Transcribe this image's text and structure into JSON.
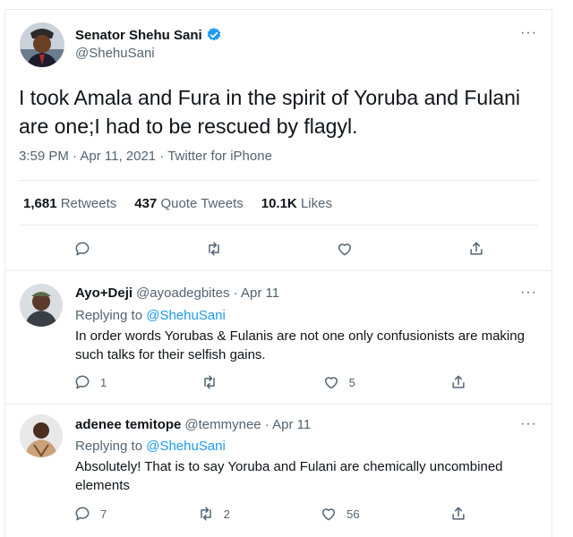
{
  "main_tweet": {
    "author_name": "Senator Shehu Sani",
    "author_handle": "@ShehuSani",
    "text": "I took Amala and Fura in the spirit of Yoruba and Fulani are one;I had to be rescued by flagyl.",
    "meta": "3:59 PM · Apr 11, 2021 · Twitter for iPhone",
    "stats": {
      "retweets_count": "1,681",
      "retweets_label": "Retweets",
      "quotes_count": "437",
      "quotes_label": "Quote Tweets",
      "likes_count": "10.1K",
      "likes_label": "Likes"
    }
  },
  "replies": [
    {
      "author_name": "Ayo+Deji",
      "author_handle": "@ayoadegbites · Apr 11",
      "replying_prefix": "Replying to",
      "replying_to": "@ShehuSani",
      "text": "In order words Yorubas & Fulanis are not one only confusionists are making such talks for their selfish gains.",
      "reply_count": "1",
      "retweet_count": "",
      "like_count": "5"
    },
    {
      "author_name": "adenee temitope",
      "author_handle": "@temmynee · Apr 11",
      "replying_prefix": "Replying to",
      "replying_to": "@ShehuSani",
      "text": "Absolutely! That is to say  Yoruba and Fulani are chemically uncombined elements",
      "reply_count": "7",
      "retweet_count": "2",
      "like_count": "56"
    }
  ],
  "more_glyph": "···",
  "colors": {
    "accent": "#1d9bf0",
    "muted": "#536471",
    "text": "#0f1419",
    "border": "#e6ecf0"
  }
}
